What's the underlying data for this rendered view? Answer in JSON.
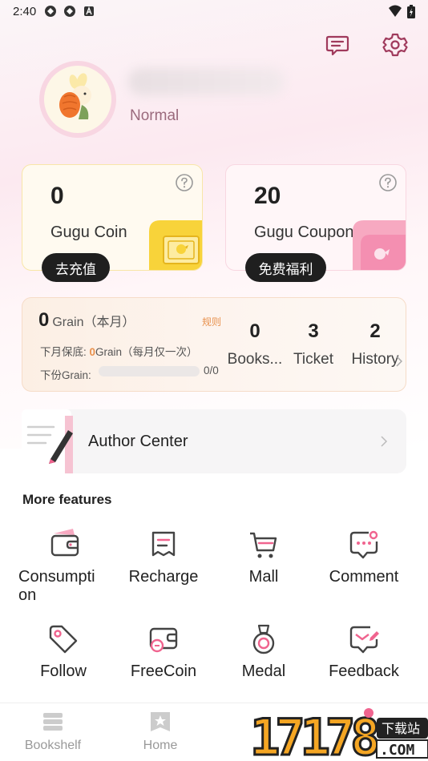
{
  "status_bar": {
    "time": "2:40"
  },
  "profile": {
    "level": "Normal"
  },
  "coin_card": {
    "value": "0",
    "label": "Gugu Coin",
    "button": "去充值"
  },
  "coupon_card": {
    "value": "20",
    "label": "Gugu Coupon",
    "button": "免费福利"
  },
  "grain": {
    "value": "0",
    "title_text": "Grain（本月）",
    "rule": "规则",
    "guarantee_prefix": "下月保底: ",
    "guarantee_value": "0",
    "guarantee_suffix": "Grain（每月仅一次）",
    "next_label": "下份Grain:",
    "progress_text": "0/0",
    "progress": 0
  },
  "stats": [
    {
      "value": "0",
      "label": "Books..."
    },
    {
      "value": "3",
      "label": "Ticket"
    },
    {
      "value": "2",
      "label": "History"
    }
  ],
  "author_center": {
    "label": "Author Center"
  },
  "more_features": {
    "title": "More features",
    "items": [
      {
        "label": "Consumpti\non",
        "icon": "wallet-icon"
      },
      {
        "label": "Recharge",
        "icon": "receipt-icon"
      },
      {
        "label": "Mall",
        "icon": "cart-icon"
      },
      {
        "label": "Comment",
        "icon": "comment-icon"
      },
      {
        "label": "Follow",
        "icon": "tag-icon"
      },
      {
        "label": "FreeCoin",
        "icon": "free-coin-icon"
      },
      {
        "label": "Medal",
        "icon": "medal-icon"
      },
      {
        "label": "Feedback",
        "icon": "feedback-icon"
      }
    ]
  },
  "tabbar": {
    "items": [
      {
        "label": "Bookshelf",
        "icon": "bookshelf-icon"
      },
      {
        "label": "Home",
        "icon": "home-star-icon"
      }
    ]
  },
  "watermark": {
    "text": "17178",
    "tag": "下载站"
  },
  "colors": {
    "accent_pink": "#f0648f",
    "grain_orange": "#e8914d",
    "coin_yellow": "#f8d33a"
  }
}
